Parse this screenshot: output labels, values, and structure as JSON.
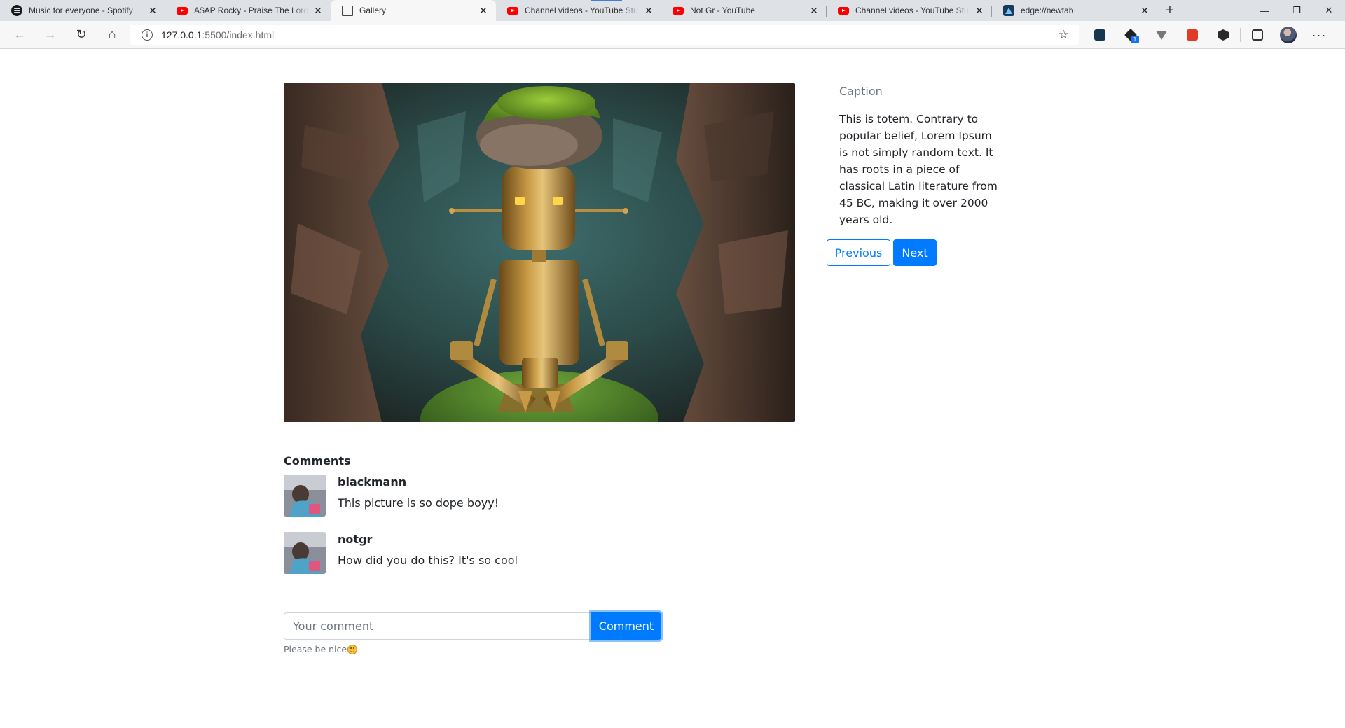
{
  "browser": {
    "tabs": [
      {
        "title": "Music for everyone - Spotify",
        "icon": "spotify-icon"
      },
      {
        "title": "A$AP Rocky - Praise The Lord (Da Shine) (Official Video)",
        "icon": "youtube-icon"
      },
      {
        "title": "Gallery",
        "icon": "document-icon",
        "active": true
      },
      {
        "title": "Channel videos - YouTube Studio",
        "icon": "youtube-icon"
      },
      {
        "title": "Not Gr - YouTube",
        "icon": "youtube-icon"
      },
      {
        "title": "Channel videos - YouTube Studio",
        "icon": "youtube-icon"
      },
      {
        "title": "edge://newtab",
        "icon": "edge-icon"
      }
    ],
    "address": {
      "host": "127.0.0.1",
      "rest": ":5500/index.html"
    }
  },
  "gallery": {
    "caption_title": "Caption",
    "caption_text": "This is totem. Contrary to popular belief, Lorem Ipsum is not simply random text. It has roots in a piece of classical Latin literature from 45 BC, making it over 2000 years old.",
    "previous_label": "Previous",
    "next_label": "Next",
    "image_subject": "golden robot totem with mossy rock head in cave"
  },
  "comments": {
    "title": "Comments",
    "items": [
      {
        "author": "blackmann",
        "text": "This picture is so dope boyy!"
      },
      {
        "author": "notgr",
        "text": "How did you do this? It's so cool"
      }
    ]
  },
  "form": {
    "placeholder": "Your comment",
    "submit_label": "Comment",
    "help_text": "Please be nice"
  },
  "colors": {
    "primary": "#007bff",
    "muted": "#6c757d"
  }
}
